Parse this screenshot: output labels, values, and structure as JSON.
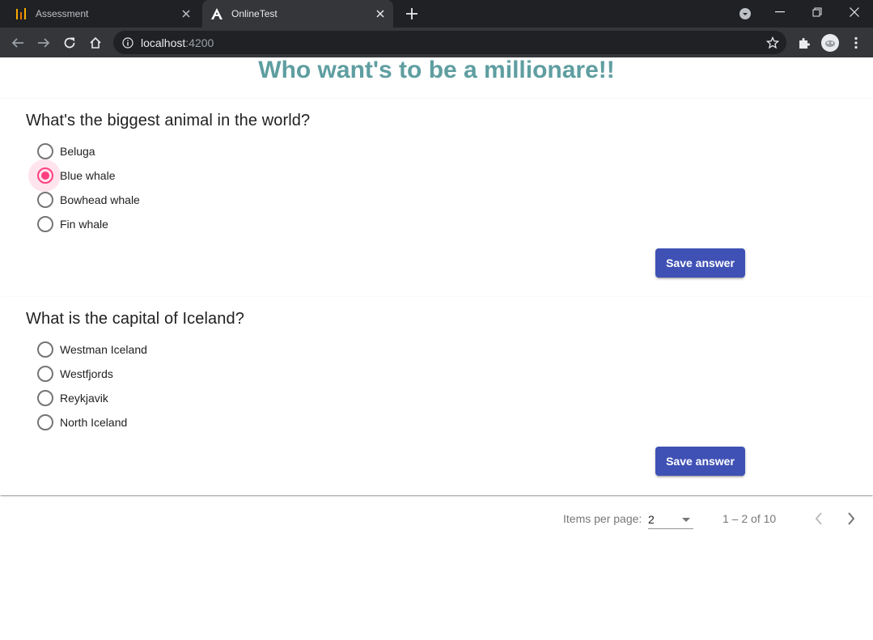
{
  "browser": {
    "tabs": [
      {
        "title": "Assessment",
        "active": false,
        "icon": "analytics-favicon"
      },
      {
        "title": "OnlineTest",
        "active": true,
        "icon": "angular-favicon"
      }
    ],
    "url_host": "localhost",
    "url_port": ":4200"
  },
  "page": {
    "title": "Who want's to be a millionare!!"
  },
  "questions": [
    {
      "text": "What's the biggest animal in the world?",
      "options": [
        "Beluga",
        "Blue whale",
        "Bowhead whale",
        "Fin whale"
      ],
      "selected": "Blue whale",
      "button_label": "Save answer"
    },
    {
      "text": "What is the capital of Iceland?",
      "options": [
        "Westman Iceland",
        "Westfjords",
        "Reykjavik",
        "North Iceland"
      ],
      "selected": null,
      "button_label": "Save answer"
    }
  ],
  "paginator": {
    "items_per_page_label": "Items per page:",
    "items_per_page_value": "2",
    "range_label": "1 – 2 of 10"
  },
  "colors": {
    "title": "#5f9ea0",
    "accent": "#ff4081",
    "primary": "#3f51b5"
  }
}
